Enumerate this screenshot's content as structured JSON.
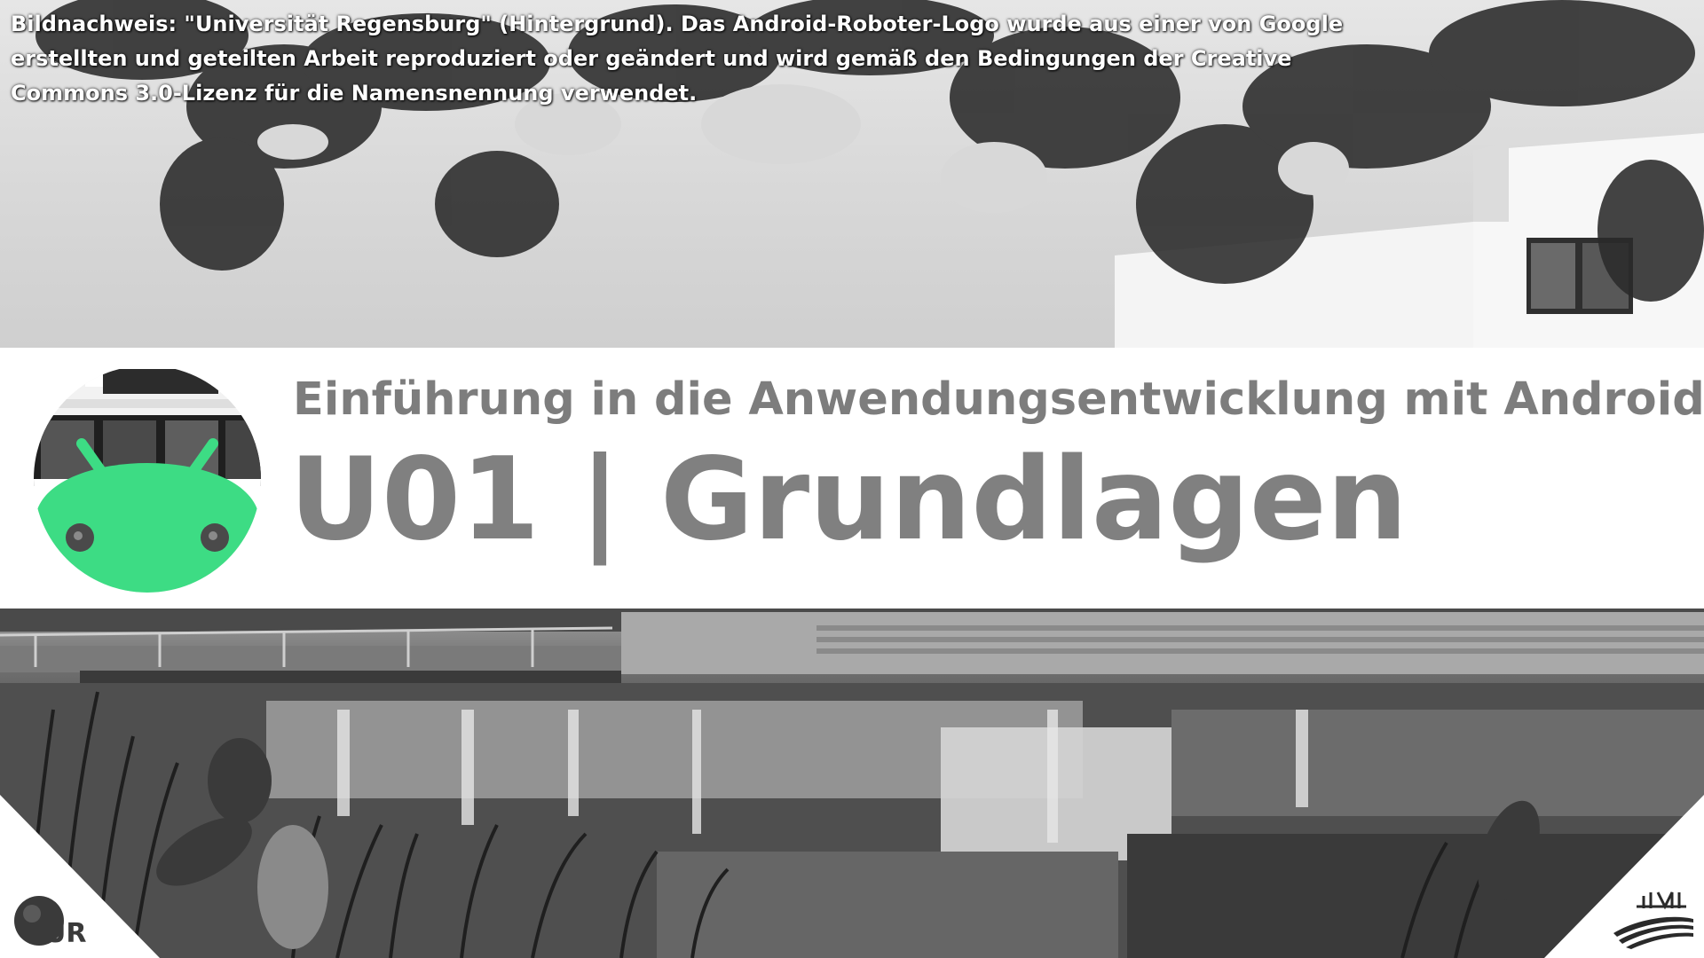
{
  "slide": {
    "credit_line_1": "Bildnachweis: \"Universität Regensburg\" (Hintergrund). Das Android-Roboter-Logo wurde aus einer von Google",
    "credit_line_2": "erstellten und geteilten Arbeit reproduziert oder geändert und wird gemäß den Bedingungen der Creative",
    "credit_line_3": "Commons 3.0-Lizenz für die Namensnennung verwendet.",
    "subtitle": "Einführung in die Anwendungsentwicklung mit Android",
    "title": "U01 | Grundlagen",
    "ur_logo_text": "UR"
  },
  "colors": {
    "title_gray": "#808080",
    "subtitle_gray": "#7d7d7d",
    "android_green": "#3ddc84",
    "band_white": "#ffffff"
  },
  "icons": {
    "android_logo": "android-robot-icon",
    "ur_logo": "university-regensburg-logo",
    "mi_logo": "media-informatics-logo"
  }
}
